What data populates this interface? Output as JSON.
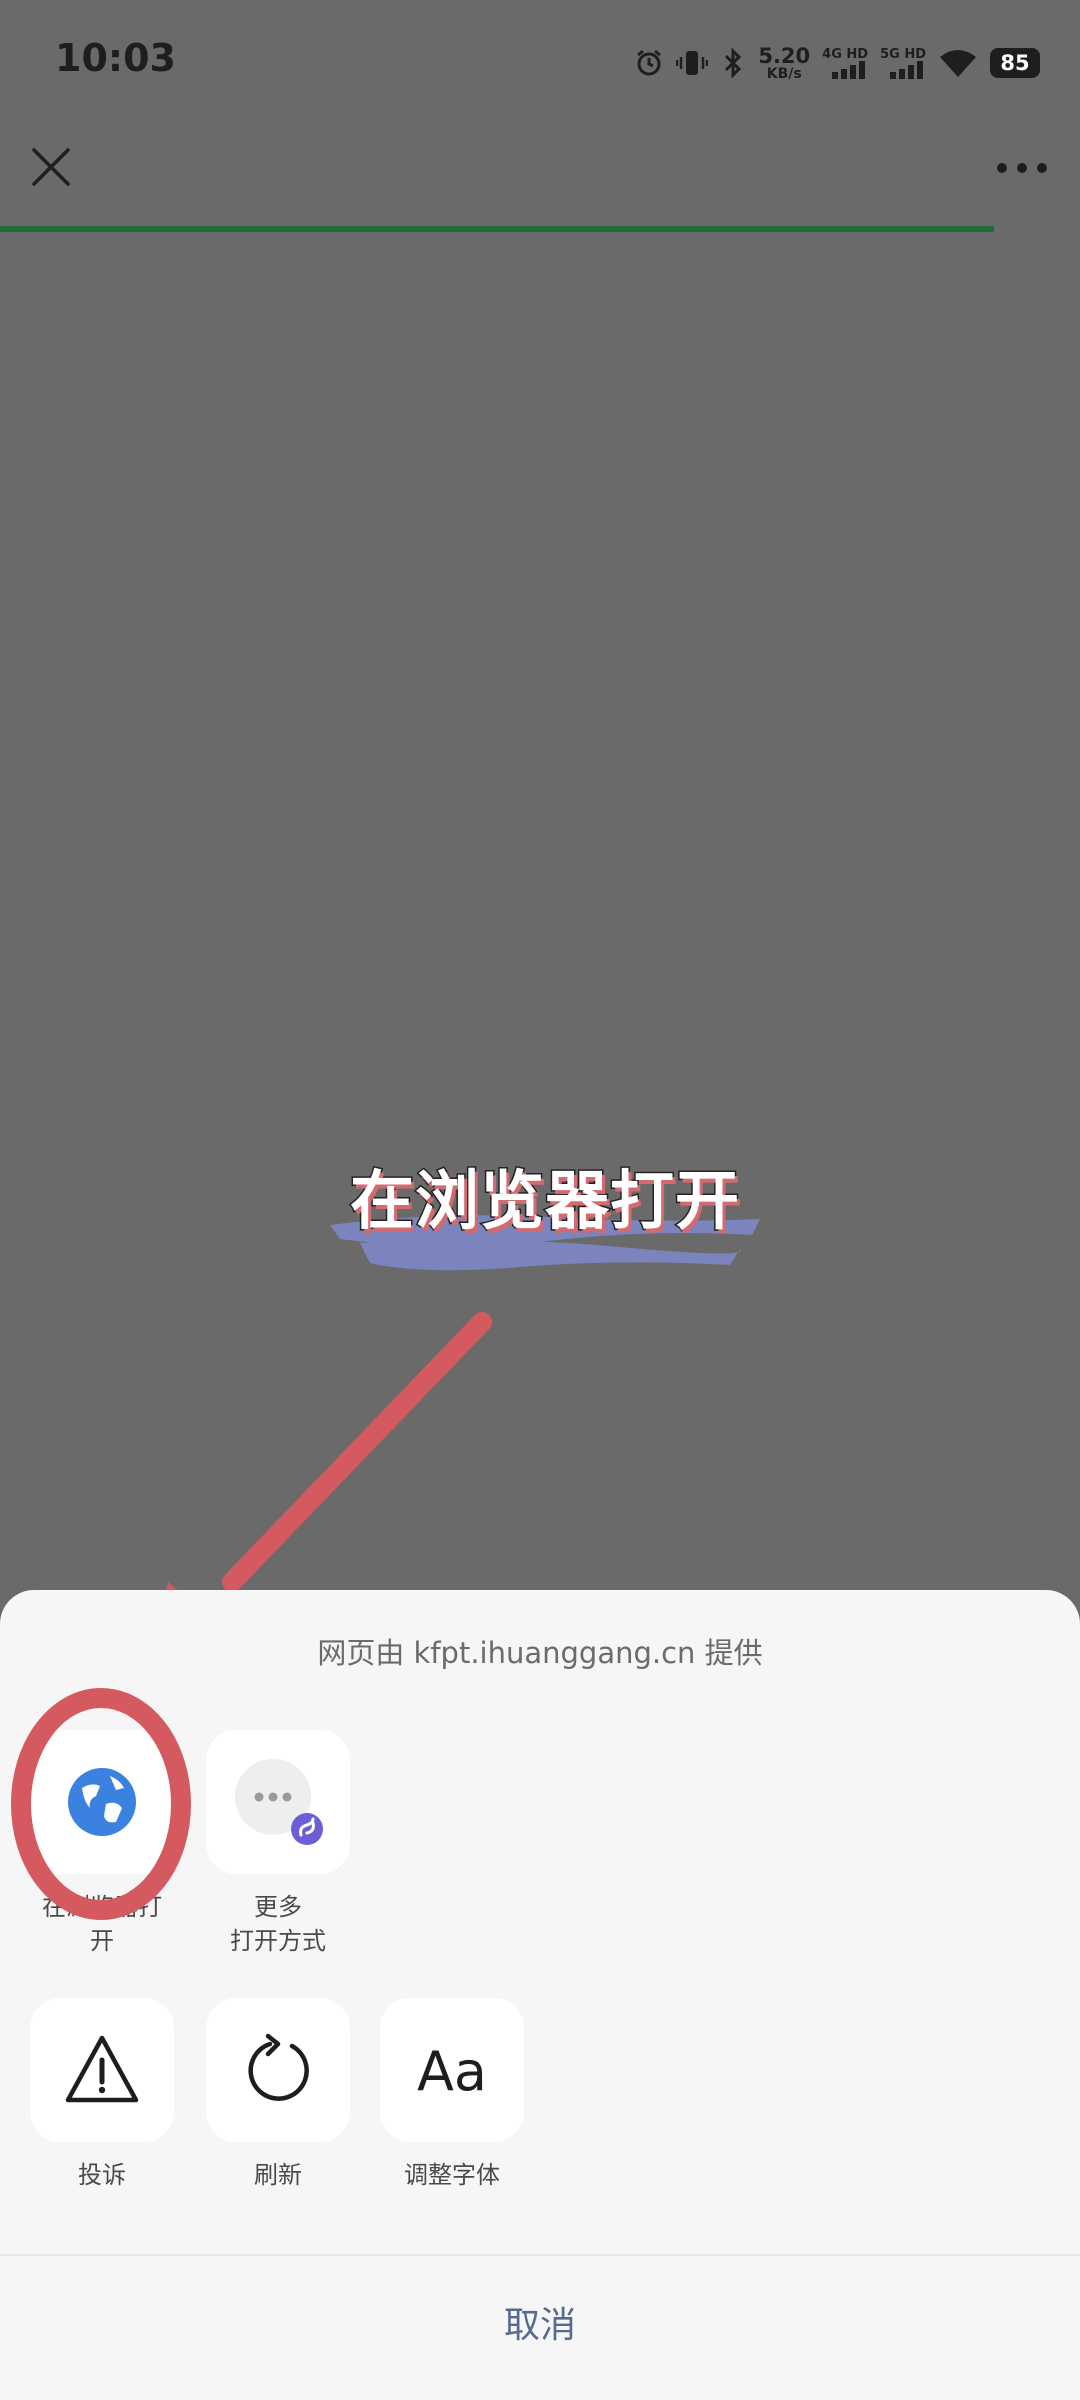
{
  "status_bar": {
    "time": "10:03",
    "net_speed_value": "5.20",
    "net_speed_unit": "KB/s",
    "sim1_label": "4G HD",
    "sim2_label": "5G HD",
    "battery": "85"
  },
  "page": {
    "load_progress": 0.92
  },
  "overlay": {
    "caption": "在浏览器打开",
    "caption_brush_color": "#7b84bd",
    "arrow_color": "#d45a60"
  },
  "sheet": {
    "provider_text": "网页由 kfpt.ihuanggang.cn 提供",
    "row1": [
      {
        "icon": "globe-icon",
        "line1": "在浏览器打",
        "line2": "开"
      },
      {
        "icon": "more-dots-icon",
        "line1": "更多",
        "line2": "打开方式"
      }
    ],
    "row2": [
      {
        "icon": "warning-icon",
        "label": "投诉"
      },
      {
        "icon": "refresh-icon",
        "label": "刷新"
      },
      {
        "icon": "font-icon",
        "glyph": "Aa",
        "label": "调整字体"
      }
    ],
    "cancel_label": "取消"
  }
}
